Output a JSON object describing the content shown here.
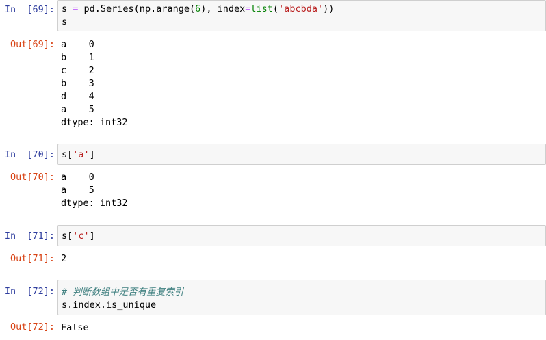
{
  "cells": [
    {
      "in_prompt": "In  [69]:",
      "out_prompt": "Out[69]:",
      "code": {
        "line1": {
          "p1": "s ",
          "op1": "=",
          "p2": " pd.Series(np.arange(",
          "num1": "6",
          "p3": "), index",
          "op2": "=",
          "kw1": "list",
          "p4": "(",
          "str1": "'abcbda'",
          "p5": "))"
        },
        "line2": "s"
      },
      "output": [
        "a    0",
        "b    1",
        "c    2",
        "b    3",
        "d    4",
        "a    5",
        "dtype: int32"
      ]
    },
    {
      "in_prompt": "In  [70]:",
      "out_prompt": "Out[70]:",
      "code": {
        "p1": "s[",
        "str1": "'a'",
        "p2": "]"
      },
      "output": [
        "a    0",
        "a    5",
        "dtype: int32"
      ]
    },
    {
      "in_prompt": "In  [71]:",
      "out_prompt": "Out[71]:",
      "code": {
        "p1": "s[",
        "str1": "'c'",
        "p2": "]"
      },
      "output": [
        "2"
      ]
    },
    {
      "in_prompt": "In  [72]:",
      "out_prompt": "Out[72]:",
      "code": {
        "comment": "# 判断数组中是否有重复索引",
        "line2": "s.index.is_unique"
      },
      "output": [
        "False"
      ]
    }
  ],
  "colors": {
    "in_prompt": "#303f9f",
    "out_prompt": "#d84315",
    "cell_bg": "#f7f7f7",
    "cell_border": "#cfcfcf",
    "keyword": "#008000",
    "string": "#ba2121",
    "operator": "#aa22ff",
    "comment": "#408080"
  }
}
